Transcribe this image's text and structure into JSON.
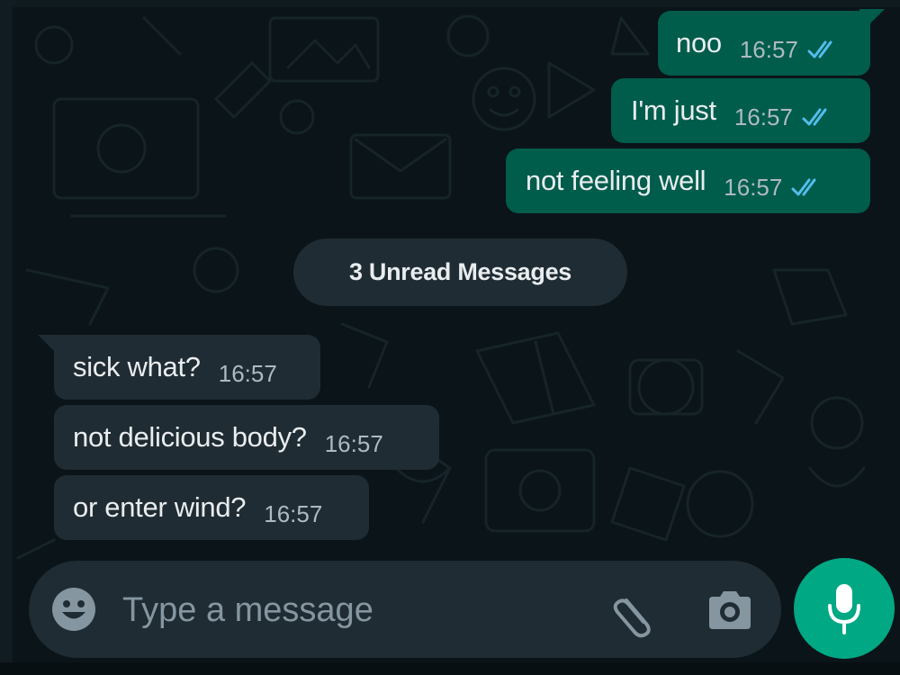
{
  "colors": {
    "background": "#0b1418",
    "outgoing_bubble": "#005c4b",
    "incoming_bubble": "#202c33",
    "read_ticks": "#53bdeb",
    "accent": "#00a884"
  },
  "outgoing_messages": [
    {
      "text": "noo",
      "time": "16:57",
      "status": "read"
    },
    {
      "text": "I'm just",
      "time": "16:57",
      "status": "read"
    },
    {
      "text": "not feeling well",
      "time": "16:57",
      "status": "read"
    }
  ],
  "unread_divider": {
    "label": "3 Unread Messages"
  },
  "incoming_messages": [
    {
      "text": "sick what?",
      "time": "16:57"
    },
    {
      "text": "not delicious body?",
      "time": "16:57"
    },
    {
      "text": "or enter wind?",
      "time": "16:57"
    }
  ],
  "composer": {
    "placeholder": "Type a message",
    "icons": [
      "emoji-icon",
      "paperclip-icon",
      "camera-icon",
      "microphone-icon"
    ]
  }
}
